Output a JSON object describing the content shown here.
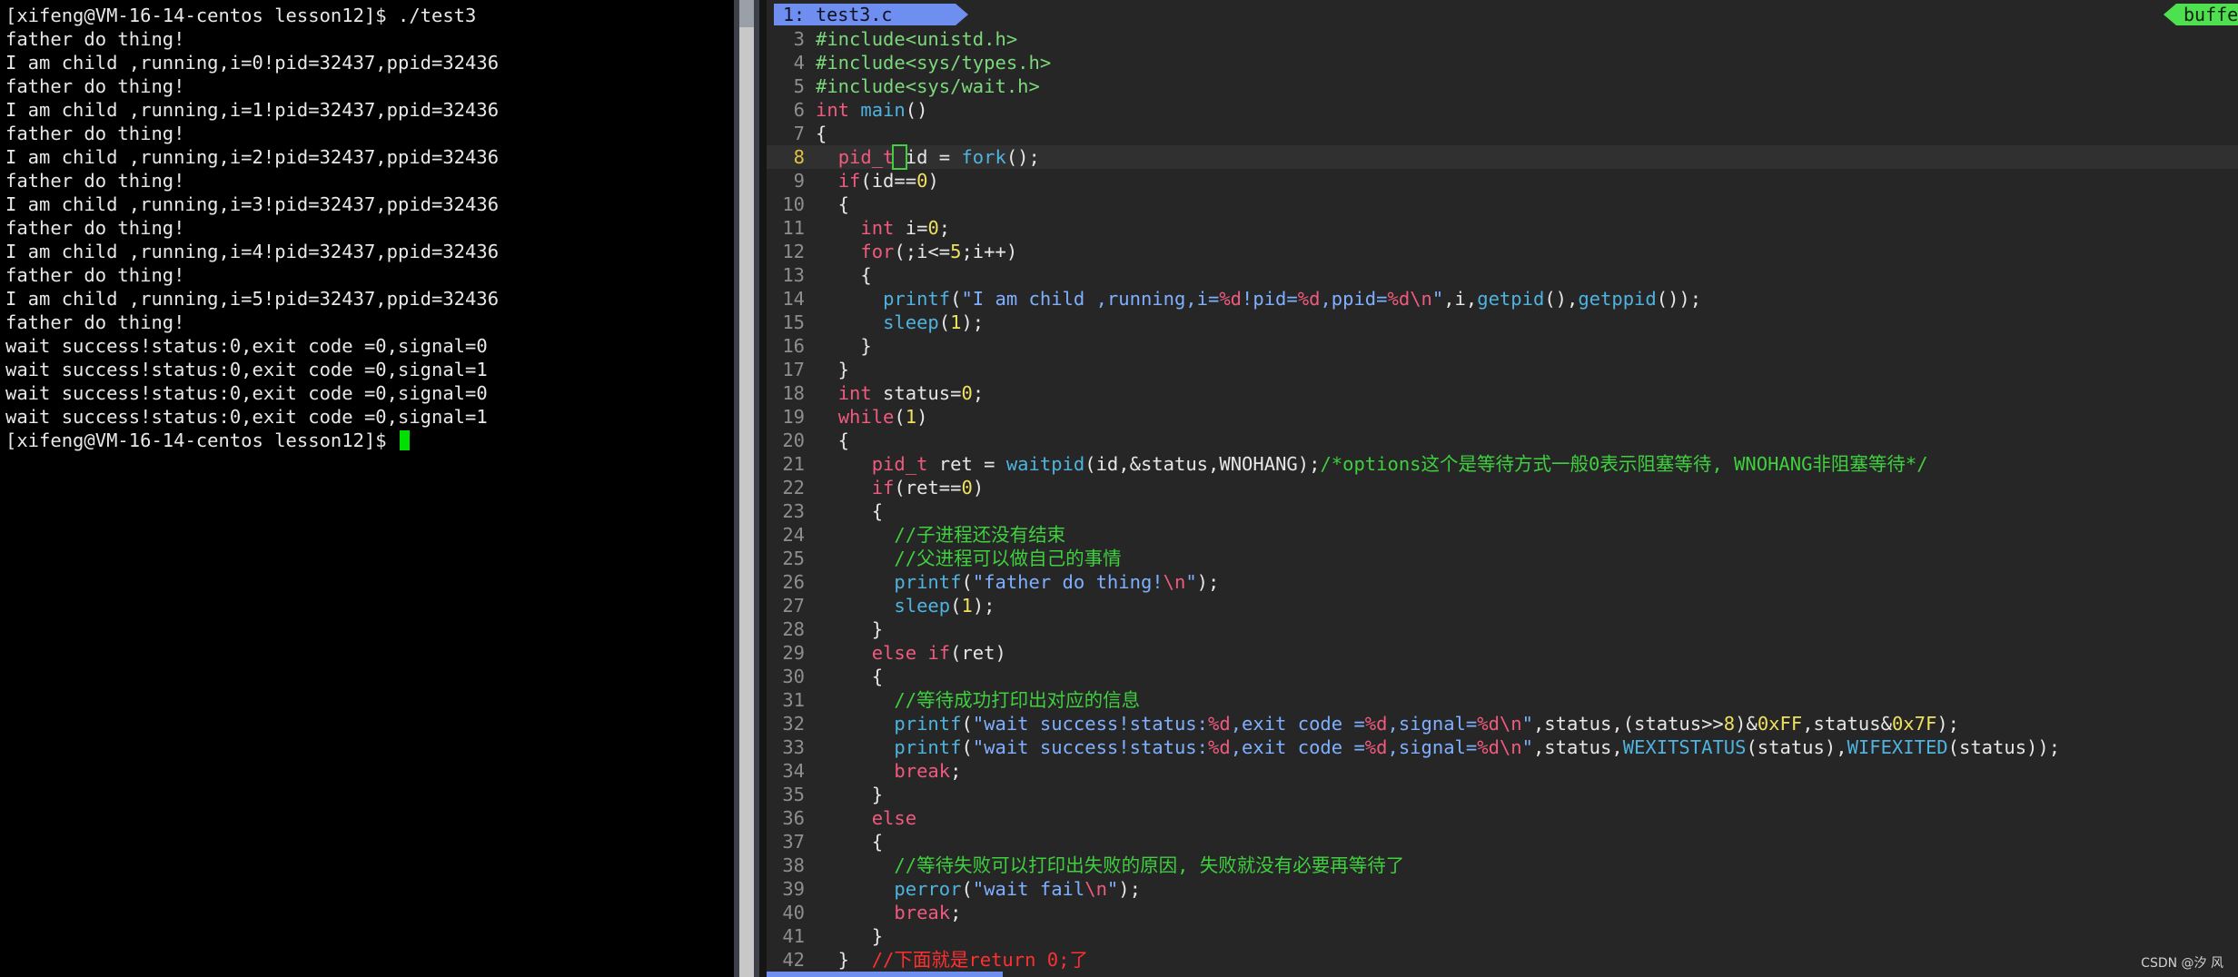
{
  "terminal": {
    "lines": [
      "[xifeng@VM-16-14-centos lesson12]$ ./test3",
      "father do thing!",
      "I am child ,running,i=0!pid=32437,ppid=32436",
      "father do thing!",
      "I am child ,running,i=1!pid=32437,ppid=32436",
      "father do thing!",
      "I am child ,running,i=2!pid=32437,ppid=32436",
      "father do thing!",
      "I am child ,running,i=3!pid=32437,ppid=32436",
      "father do thing!",
      "I am child ,running,i=4!pid=32437,ppid=32436",
      "father do thing!",
      "I am child ,running,i=5!pid=32437,ppid=32436",
      "father do thing!",
      "wait success!status:0,exit code =0,signal=0",
      "wait success!status:0,exit code =0,signal=1",
      "wait success!status:0,exit code =0,signal=0",
      "wait success!status:0,exit code =0,signal=1"
    ],
    "prompt": "[xifeng@VM-16-14-centos lesson12]$ ",
    "cursor_color": "#00e000"
  },
  "editor": {
    "tab_label": "1: test3.c",
    "buffer_label": "buffe",
    "current_line": 8,
    "colors": {
      "tab": "#6f8ff0",
      "buffer": "#4fe04f",
      "background": "#262626"
    },
    "lines": [
      {
        "n": "3",
        "src": "#include<unistd.h>"
      },
      {
        "n": "4",
        "src": "#include<sys/types.h>"
      },
      {
        "n": "5",
        "src": "#include<sys/wait.h>"
      },
      {
        "n": "6",
        "src": "int main()"
      },
      {
        "n": "7",
        "src": "{"
      },
      {
        "n": "8",
        "src": "  pid_t id = fork();"
      },
      {
        "n": "9",
        "src": "  if(id==0)"
      },
      {
        "n": "10",
        "src": "  {"
      },
      {
        "n": "11",
        "src": "    int i=0;"
      },
      {
        "n": "12",
        "src": "    for(;i<=5;i++)"
      },
      {
        "n": "13",
        "src": "    {"
      },
      {
        "n": "14",
        "src": "      printf(\"I am child ,running,i=%d!pid=%d,ppid=%d\\n\",i,getpid(),getppid());"
      },
      {
        "n": "15",
        "src": "      sleep(1);"
      },
      {
        "n": "16",
        "src": "    }"
      },
      {
        "n": "17",
        "src": "  }"
      },
      {
        "n": "18",
        "src": "  int status=0;"
      },
      {
        "n": "19",
        "src": "  while(1)"
      },
      {
        "n": "20",
        "src": "  {"
      },
      {
        "n": "21",
        "src": "     pid_t ret = waitpid(id,&status,WNOHANG);/*options这个是等待方式一般0表示阻塞等待, WNOHANG非阻塞等待*/"
      },
      {
        "n": "22",
        "src": "     if(ret==0)"
      },
      {
        "n": "23",
        "src": "     {"
      },
      {
        "n": "24",
        "src": "       //子进程还没有结束"
      },
      {
        "n": "25",
        "src": "       //父进程可以做自己的事情"
      },
      {
        "n": "26",
        "src": "       printf(\"father do thing!\\n\");"
      },
      {
        "n": "27",
        "src": "       sleep(1);"
      },
      {
        "n": "28",
        "src": "     }"
      },
      {
        "n": "29",
        "src": "     else if(ret)"
      },
      {
        "n": "30",
        "src": "     {"
      },
      {
        "n": "31",
        "src": "       //等待成功打印出对应的信息"
      },
      {
        "n": "32",
        "src": "       printf(\"wait success!status:%d,exit code =%d,signal=%d\\n\",status,(status>>8)&0xFF,status&0x7F);"
      },
      {
        "n": "33",
        "src": "       printf(\"wait success!status:%d,exit code =%d,signal=%d\\n\",status,WEXITSTATUS(status),WIFEXITED(status));"
      },
      {
        "n": "34",
        "src": "       break;"
      },
      {
        "n": "35",
        "src": "     }"
      },
      {
        "n": "36",
        "src": "     else"
      },
      {
        "n": "37",
        "src": "     {"
      },
      {
        "n": "38",
        "src": "       //等待失败可以打印出失败的原因, 失败就没有必要再等待了"
      },
      {
        "n": "39",
        "src": "       perror(\"wait fail\\n\");"
      },
      {
        "n": "40",
        "src": "       break;"
      },
      {
        "n": "41",
        "src": "     }"
      },
      {
        "n": "42",
        "src": "  }  //下面就是return 0;了"
      }
    ]
  },
  "watermark": "CSDN @汐  风"
}
